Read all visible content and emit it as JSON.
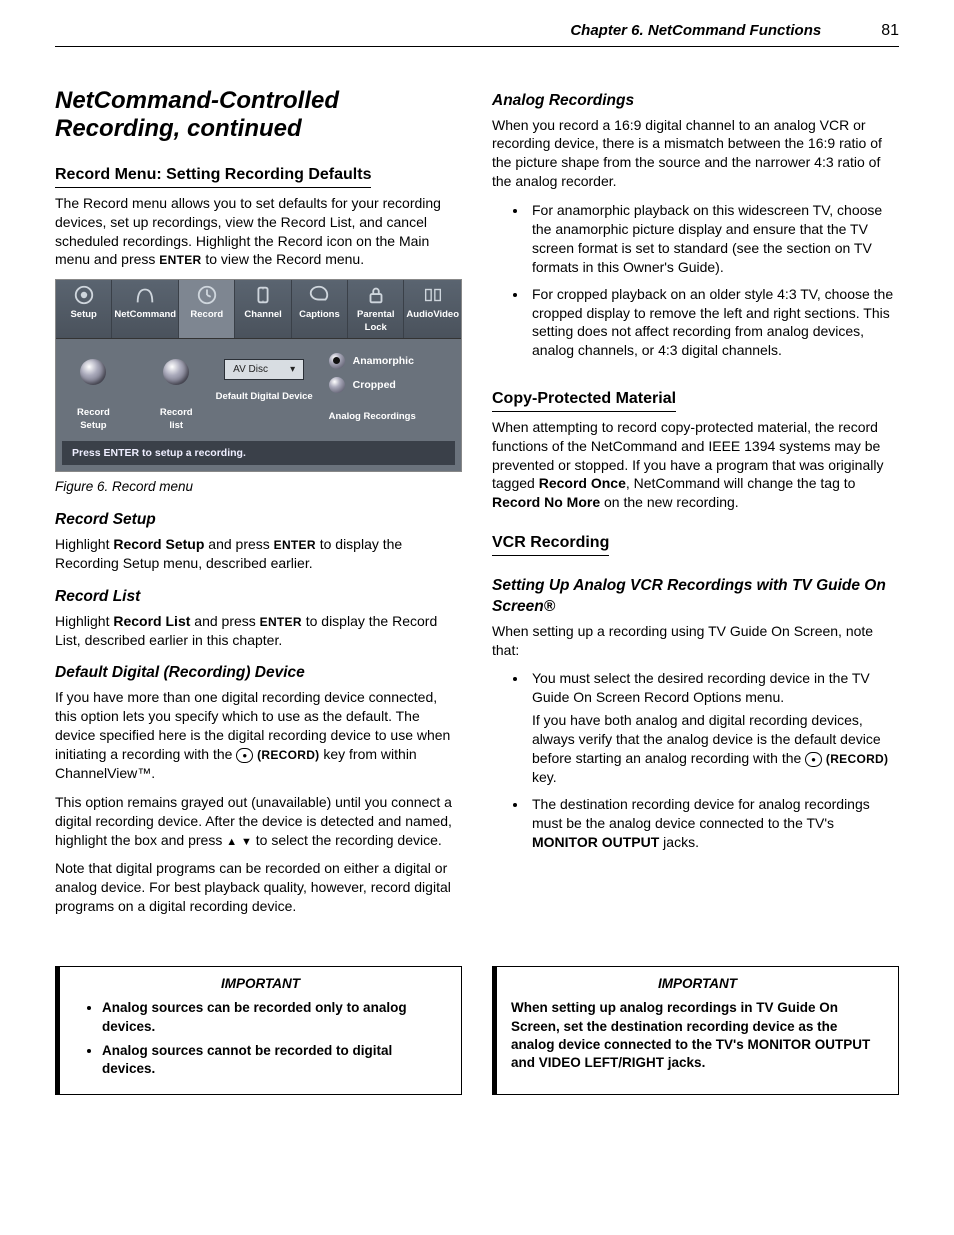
{
  "header": {
    "chapter": "Chapter 6.  NetCommand Functions",
    "page": "81"
  },
  "title": "NetCommand-Controlled Recording, continued",
  "left": {
    "sec1_h": "Record Menu:  Setting Recording Defaults",
    "sec1_p": "The Record menu allows you to set defaults for your recording devices, set up recordings, view the Record List, and cancel scheduled recordings.  Highlight the Record icon on the Main menu and press ",
    "sec1_p2": " to view the Record menu.",
    "enter": "ENTER",
    "figcap": "Figure 6. Record menu",
    "rs_h": "Record Setup",
    "rs_p1a": "Highlight ",
    "rs_p1b": "Record Setup",
    "rs_p1c": " and press ",
    "rs_p1d": " to display the Recording Setup menu, described earlier.",
    "rl_h": "Record List",
    "rl_p1a": "Highlight ",
    "rl_p1b": "Record List",
    "rl_p1c": " and press ",
    "rl_p1d": " to display the Record List, described earlier in this chapter.",
    "dd_h": "Default Digital (Recording) Device",
    "dd_p1": "If you have more than one digital recording device connected, this option lets you specify which to use as the default.  The device specified here is the digital recording device to use when initiating a recording with the ",
    "dd_p1b": " key from within ChannelView™.",
    "record_key": "(RECORD)",
    "dd_p2a": "This option remains grayed out (unavailable) until you connect a digital recording device.  After the device is detected and named, highlight the box and press ",
    "dd_p2b": " to select the recording device.",
    "dd_p3": "Note that digital programs can be recorded on either a digital or analog device.  For best playback quality, however, record digital programs on a digital recording device."
  },
  "menu": {
    "tabs": [
      "Setup",
      "NetCommand",
      "Record",
      "Channel",
      "Captions",
      "Parental Lock",
      "AudioVideo"
    ],
    "left_items": [
      "Record Setup",
      "Record list"
    ],
    "dropdown": "AV Disc",
    "dropdown_label": "Default Digital Device",
    "radios": [
      "Anamorphic",
      "Cropped"
    ],
    "right_label": "Analog Recordings",
    "footer": "Press ENTER to setup a recording."
  },
  "right": {
    "ar_h": "Analog Recordings",
    "ar_p": "When you record a 16:9 digital channel to an analog VCR or recording device, there is a mismatch between the 16:9 ratio of the picture shape from the source and the narrower 4:3 ratio of the analog recorder.",
    "ar_b1": "For anamorphic playback on this widescreen TV, choose the anamorphic picture display and ensure that the TV screen format is set to standard (see the section on TV formats in this Owner's Guide).",
    "ar_b2": "For cropped playback on an older style 4:3 TV, choose the cropped display to remove the left and right sections.  This setting does not affect recording from analog devices, analog channels, or 4:3 digital channels.",
    "cp_h": "Copy-Protected Material",
    "cp_p1a": "When attempting to record copy-protected material, the record functions of the NetCommand and IEEE 1394 systems may be prevented or stopped.  If you have a program that was originally tagged ",
    "cp_p1b": "Record Once",
    "cp_p1c": ", NetCommand will change the tag to ",
    "cp_p1d": "Record No More",
    "cp_p1e": " on the new recording.",
    "vcr_h": "VCR Recording",
    "vcr_sub": "Setting Up Analog VCR Recordings with TV Guide On Screen®",
    "vcr_p": "When setting up a recording using TV Guide On Screen, note that:",
    "vcr_b1": "You must select the desired recording device in the TV Guide On Screen Record Options menu.",
    "vcr_b1_sub_a": "If you have both analog and digital recording devices, always verify that the analog device is the default device before starting an analog recording with the ",
    "vcr_b1_sub_b": " key.",
    "vcr_b2a": "The destination recording device for analog recordings must be the analog device connected to the TV's ",
    "vcr_b2b": "MONITOR OUTPUT",
    "vcr_b2c": " jacks."
  },
  "important": {
    "title": "IMPORTANT",
    "left_b1": "Analog sources can be recorded only to analog devices.",
    "left_b2": "Analog sources cannot be recorded to digital devices.",
    "right_a": "When setting up analog recordings in TV Guide On Screen, set the destination recording device as the analog device connected to the TV's ",
    "right_b": "MONITOR OUTPUT",
    "right_c": " and ",
    "right_d": "VIDEO LEFT/RIGHT",
    "right_e": " jacks."
  }
}
